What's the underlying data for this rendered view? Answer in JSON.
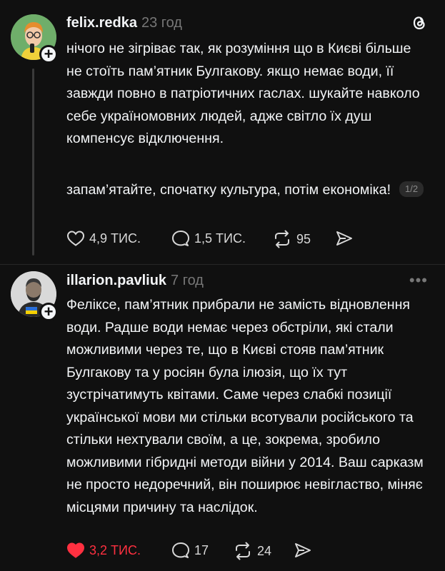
{
  "posts": [
    {
      "username": "felix.redka",
      "time": "23 год",
      "paragraphs": [
        "нічого не зігріває так, як розуміння що в Києві більше не стоїть пам’ятник Булгакову. якщо немає води, її завжди повно в патріотичних гаслах. шукайте навколо себе україномовних людей, адже світло їх душ компенсує відключення.",
        "запам’ятайте, спочатку культура, потім економіка!"
      ],
      "pager": "1/2",
      "likes": "4,9 ТИС.",
      "replies": "1,5 ТИС.",
      "reposts": "95",
      "liked": false
    },
    {
      "username": "illarion.pavliuk",
      "time": "7 год",
      "paragraphs": [
        "Феліксе, пам’ятник прибрали не замість відновлення води. Радше води немає через обстріли, які стали можливими через те, що в Києві стояв пам’ятник Булгакову та у росіян була ілюзія, що їх тут зустрічатимуть квітами. Саме через слабкі позиції української мови ми стільки всотували російського та стільки нехтували своїм, а це, зокрема, зробило можливими гібридні методи війни у 2014. Ваш сарказм не просто недоречний, він поширює невігластво, міняє місцями причину та наслідок."
      ],
      "likes": "3,2 ТИС.",
      "replies": "17",
      "reposts": "24",
      "liked": true
    }
  ],
  "colors": {
    "accent_like": "#ff3040",
    "background": "#101010",
    "text": "#f3f5f7",
    "muted": "#777777"
  },
  "icons": [
    "threads-logo-icon",
    "heart-icon",
    "comment-icon",
    "repost-icon",
    "share-icon",
    "more-icon",
    "follow-plus-icon"
  ]
}
